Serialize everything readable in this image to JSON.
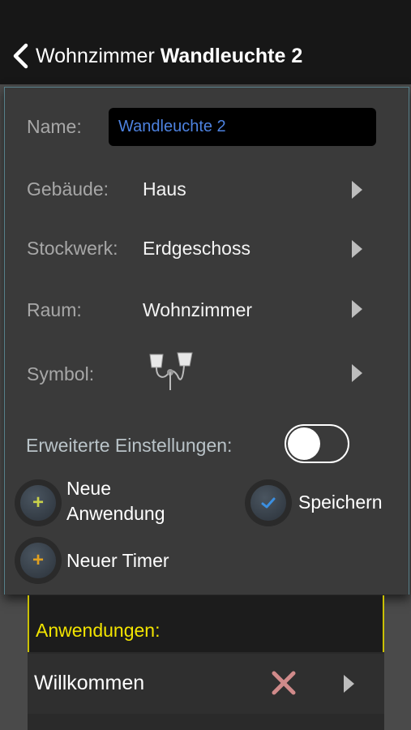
{
  "nav": {
    "parent": "Wohnzimmer",
    "title": "Wandleuchte 2"
  },
  "form": {
    "name_label": "Name:",
    "name_value": "Wandleuchte 2",
    "building_label": "Gebäude:",
    "building_value": "Haus",
    "floor_label": "Stockwerk:",
    "floor_value": "Erdgeschoss",
    "room_label": "Raum:",
    "room_value": "Wohnzimmer",
    "symbol_label": "Symbol:",
    "symbol_icon": "wall-lamp-icon",
    "advanced_label": "Erweiterte Einstellungen:",
    "advanced_enabled": false
  },
  "actions": {
    "new_app_line1": "Neue",
    "new_app_line2": "Anwendung",
    "save": "Speichern",
    "new_timer": "Neuer Timer"
  },
  "applications": {
    "header": "Anwendungen:",
    "items": [
      {
        "label": "Willkommen"
      }
    ]
  },
  "colors": {
    "accent_blue": "#4d82e0",
    "header_yellow": "#f2e400",
    "plus_green": "#c9d24a",
    "plus_orange": "#e0a020",
    "check_blue": "#3b8fe0",
    "delete_red": "#d08a8a"
  }
}
